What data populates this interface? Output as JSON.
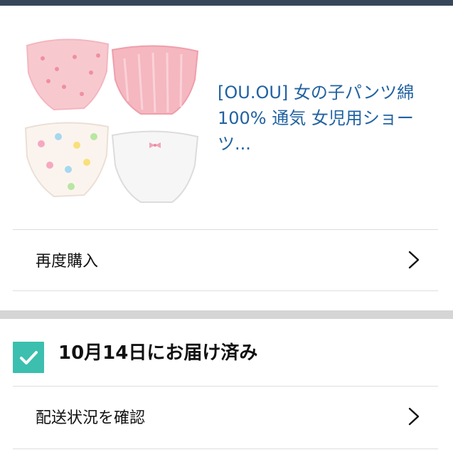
{
  "product": {
    "title": "[OU.OU] 女の子パンツ綿100% 通気 女児用ショーツ...",
    "image_icon": "children-underwear-product-photo"
  },
  "actions": {
    "buy_again": "再度購入"
  },
  "delivery": {
    "status_text": "10月14日にお届け済み",
    "status_icon": "checkmark-icon",
    "status_color": "#3cbfae",
    "track_label": "配送状況を確認"
  },
  "theme": {
    "link_color": "#2162a1",
    "topbar_color": "#37475a"
  }
}
